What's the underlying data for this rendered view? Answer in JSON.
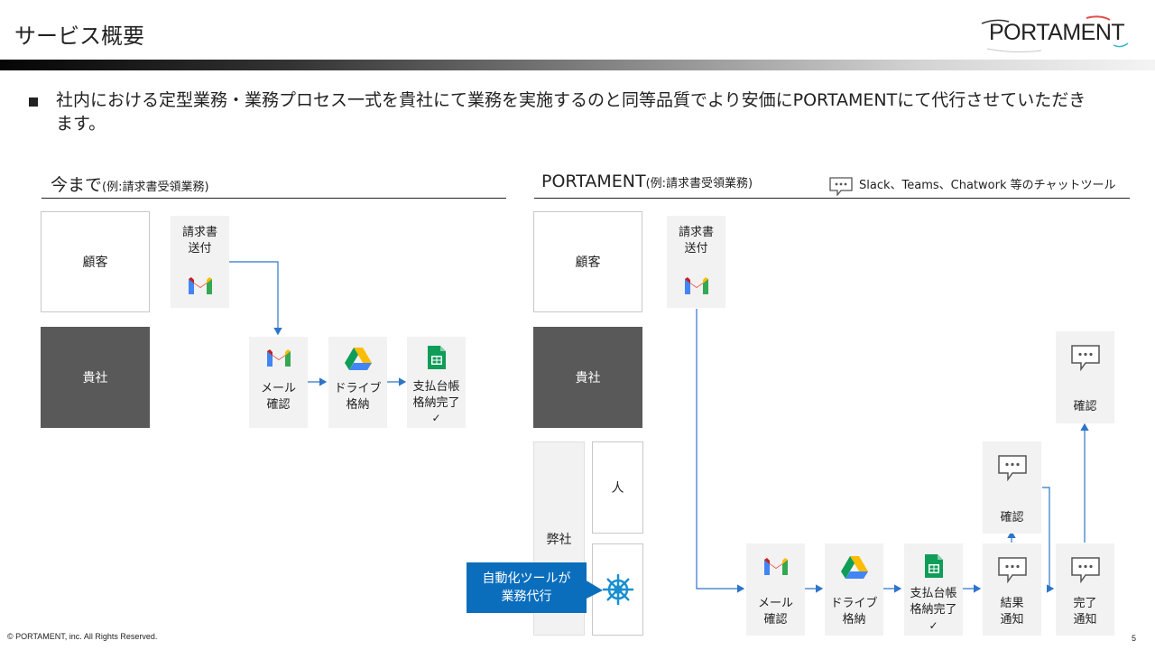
{
  "slide": {
    "title": "サービス概要",
    "page_number": "5",
    "copyright": "© PORTAMENT, inc. All Rights Reserved."
  },
  "logo": {
    "text": "PORTAMENT"
  },
  "bullet": {
    "text": "社内における定型業務・業務プロセス一式を貴社にて業務を実施するのと同等品質でより安価にPORTAMENTにて代行させていただきます。"
  },
  "left": {
    "title": "今まで",
    "subtitle": "(例:請求書受領業務)",
    "lanes": {
      "customer": "顧客",
      "company": "貴社"
    },
    "steps": {
      "invoice_line1": "請求書",
      "invoice_line2": "送付",
      "mail_line1": "メール",
      "mail_line2": "確認",
      "drive_line1": "ドライブ",
      "drive_line2": "格納",
      "ledger_line1": "支払台帳",
      "ledger_line2": "格納完了",
      "ledger_check": "✓"
    }
  },
  "right": {
    "title": "PORTAMENT",
    "subtitle": "(例:請求書受領業務)",
    "legend": "Slack、Teams、Chatwork 等のチャットツール",
    "lanes": {
      "customer": "顧客",
      "company": "貴社",
      "us": "弊社",
      "person": "人"
    },
    "callout_line1": "自動化ツールが",
    "callout_line2": "業務代行",
    "steps": {
      "invoice_line1": "請求書",
      "invoice_line2": "送付",
      "mail_line1": "メール",
      "mail_line2": "確認",
      "drive_line1": "ドライブ",
      "drive_line2": "格納",
      "ledger_line1": "支払台帳",
      "ledger_line2": "格納完了",
      "ledger_check": "✓",
      "result_line1": "結果",
      "result_line2": "通知",
      "done_line1": "完了",
      "done_line2": "通知",
      "confirm_person": "確認",
      "confirm_company": "確認"
    }
  },
  "colors": {
    "arrow": "#2e75c8",
    "callout": "#0a6ebd",
    "dark_lane": "#595959",
    "tile": "#f2f2f2"
  },
  "icons": [
    "gmail-icon",
    "google-drive-icon",
    "google-sheets-icon",
    "chat-bubble-icon",
    "ship-wheel-icon"
  ]
}
